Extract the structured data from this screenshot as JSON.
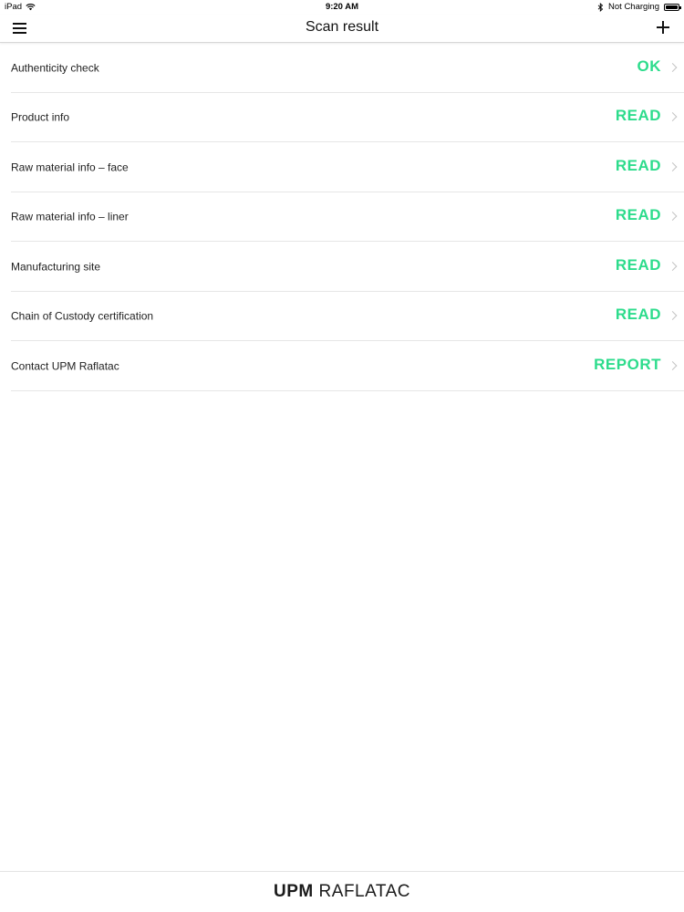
{
  "status_bar": {
    "device": "iPad",
    "time": "9:20 AM",
    "charging": "Not Charging"
  },
  "nav": {
    "title": "Scan result",
    "menu_icon": "hamburger-icon",
    "add_icon": "plus-icon"
  },
  "rows": [
    {
      "label": "Authenticity check",
      "status": "OK"
    },
    {
      "label": "Product info",
      "status": "READ"
    },
    {
      "label": "Raw material info – face",
      "status": "READ"
    },
    {
      "label": "Raw material info – liner",
      "status": "READ"
    },
    {
      "label": "Manufacturing site",
      "status": "READ"
    },
    {
      "label": "Chain of Custody certification",
      "status": "READ"
    },
    {
      "label": "Contact UPM Raflatac",
      "status": "REPORT"
    }
  ],
  "footer": {
    "brand_bold": "UPM",
    "brand_light": "RAFLATAC"
  },
  "colors": {
    "status_green": "#2ddc8c",
    "text": "#222222",
    "divider": "#e6e6e6"
  }
}
